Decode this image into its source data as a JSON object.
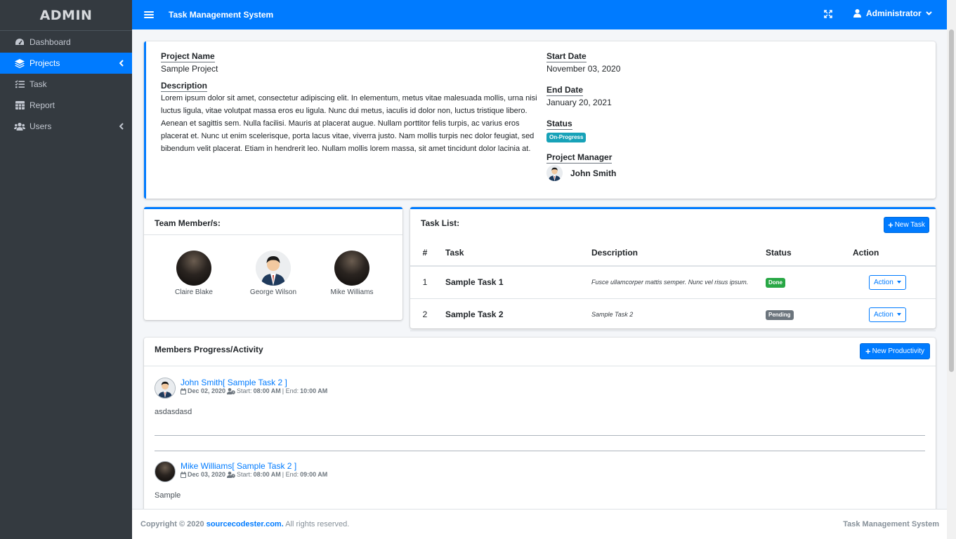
{
  "brand": "ADMIN",
  "sidebar": {
    "items": [
      {
        "label": "Dashboard",
        "icon": "dashboard-icon"
      },
      {
        "label": "Projects",
        "icon": "layers-icon",
        "active": true
      },
      {
        "label": "Task",
        "icon": "tasks-icon"
      },
      {
        "label": "Report",
        "icon": "table-icon"
      },
      {
        "label": "Users",
        "icon": "users-icon"
      }
    ]
  },
  "topbar": {
    "title": "Task Management System",
    "user": "Administrator"
  },
  "project": {
    "name_label": "Project Name",
    "name": "Sample Project",
    "description_label": "Description",
    "description": "Lorem ipsum dolor sit amet, consectetur adipiscing elit. In elementum, metus vitae malesuada mollis, urna nisi luctus ligula, vitae volutpat massa eros eu ligula. Nunc dui metus, iaculis id dolor non, luctus tristique libero. Aenean et sagittis sem. Nulla facilisi. Mauris at placerat augue. Nullam porttitor felis turpis, ac varius eros placerat et. Nunc ut enim scelerisque, porta lacus vitae, viverra justo. Nam mollis turpis nec dolor feugiat, sed bibendum velit placerat. Etiam in hendrerit leo. Nullam mollis lorem massa, sit amet tincidunt dolor lacinia at.",
    "start_label": "Start Date",
    "start": "November 03, 2020",
    "end_label": "End Date",
    "end": "January 20, 2021",
    "status_label": "Status",
    "status": "On-Progress",
    "manager_label": "Project Manager",
    "manager": "John Smith"
  },
  "team": {
    "title": "Team Member/s:",
    "members": [
      "Claire Blake",
      "George Wilson",
      "Mike Williams"
    ]
  },
  "tasks": {
    "title": "Task List:",
    "new_button": "New Task",
    "columns": [
      "#",
      "Task",
      "Description",
      "Status",
      "Action"
    ],
    "rows": [
      {
        "num": "1",
        "task": "Sample Task 1",
        "description": "Fusce ullamcorper mattis semper. Nunc vel risus ipsum.",
        "status": "Done",
        "action": "Action"
      },
      {
        "num": "2",
        "task": "Sample Task 2",
        "description": "Sample Task 2",
        "status": "Pending",
        "action": "Action"
      }
    ]
  },
  "progress": {
    "title": "Members Progress/Activity",
    "new_button": "New Productivity",
    "posts": [
      {
        "user": "John Smith[ Sample Task 2 ]",
        "date": "Dec 02, 2020",
        "start_label": "Start:",
        "start": "08:00 AM",
        "end_label": "| End:",
        "end": "10:00 AM",
        "body": "asdasdasd"
      },
      {
        "user": "Mike Williams[ Sample Task 2 ]",
        "date": "Dec 03, 2020",
        "start_label": "Start:",
        "start": "08:00 AM",
        "end_label": "| End:",
        "end": "09:00 AM",
        "body": "Sample"
      }
    ]
  },
  "footer": {
    "copyright": "Copyright © 2020",
    "link": "sourcecodester.com.",
    "rights": "All rights reserved.",
    "right": "Task Management System"
  },
  "colors": {
    "primary": "#007bff",
    "sidebar": "#343a40",
    "info": "#17a2b8",
    "success": "#28a745",
    "secondary": "#6c757d"
  }
}
